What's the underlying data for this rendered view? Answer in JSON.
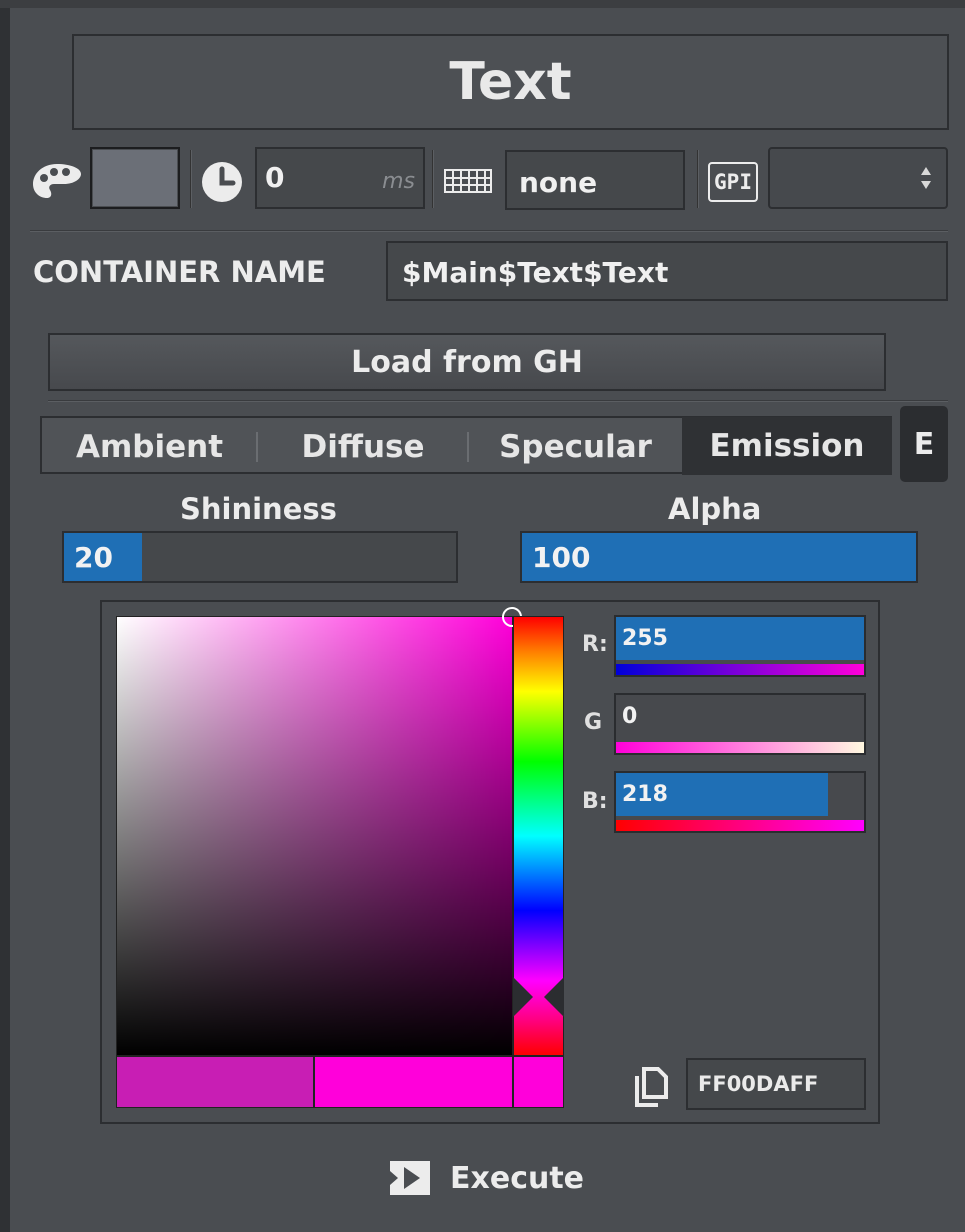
{
  "header": {
    "title": "Text"
  },
  "toolbar": {
    "color_swatch": "#6b6f77",
    "delay_value": "0",
    "delay_unit": "ms",
    "keyboard_value": "none",
    "gpi_label": "GPI",
    "gpi_select_value": ""
  },
  "container": {
    "label": "CONTAINER NAME",
    "value": "$Main$Text$Text"
  },
  "load_button": {
    "label": "Load from GH"
  },
  "tabs": [
    {
      "label": "Ambient",
      "active": false
    },
    {
      "label": "Diffuse",
      "active": false
    },
    {
      "label": "Specular",
      "active": false
    },
    {
      "label": "Emission",
      "active": true
    },
    {
      "label": "E",
      "active": false
    }
  ],
  "shininess": {
    "label": "Shininess",
    "value": "20",
    "fraction": 0.2
  },
  "alpha": {
    "label": "Alpha",
    "value": "100",
    "fraction": 1.0
  },
  "color_picker": {
    "hue_color": "#ff00da",
    "previous_color": "#c81eb4",
    "current_color": "#ff00da",
    "r": {
      "label": "R:",
      "value": "255",
      "fraction": 1.0
    },
    "g": {
      "label": "G",
      "value": "0",
      "fraction": 0.0
    },
    "b": {
      "label": "B:",
      "value": "218",
      "fraction": 0.855
    },
    "hex_value": "FF00DAFF"
  },
  "execute": {
    "label": "Execute"
  },
  "colors": {
    "accent_blue": "#1f6fb5",
    "panel_bg": "#4a4d51",
    "border_dark": "#2c2e31"
  }
}
